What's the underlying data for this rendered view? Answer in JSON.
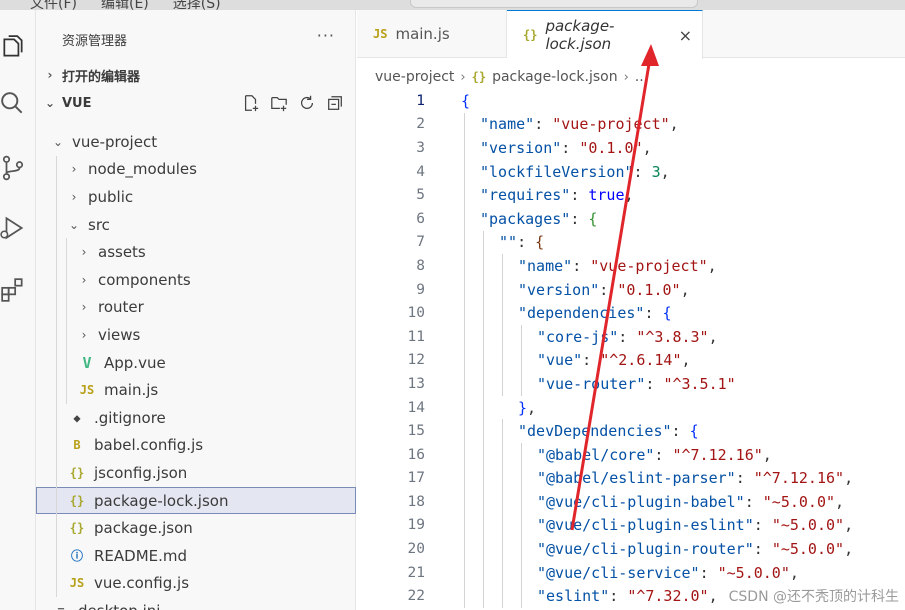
{
  "menu": {
    "items": [
      "文件(F)",
      "编辑(E)",
      "选择(S)"
    ]
  },
  "sidebar": {
    "title": "资源管理器",
    "more": "···",
    "open_editors": "打开的编辑器",
    "workspace": "VUE",
    "tree": [
      {
        "label": "vue-project",
        "chev": "⌄",
        "icon": "",
        "depth": 0
      },
      {
        "label": "node_modules",
        "chev": "›",
        "icon": "",
        "depth": 1
      },
      {
        "label": "public",
        "chev": "›",
        "icon": "",
        "depth": 1
      },
      {
        "label": "src",
        "chev": "⌄",
        "icon": "",
        "depth": 1
      },
      {
        "label": "assets",
        "chev": "›",
        "icon": "",
        "depth": 2
      },
      {
        "label": "components",
        "chev": "›",
        "icon": "",
        "depth": 2
      },
      {
        "label": "router",
        "chev": "›",
        "icon": "",
        "depth": 2
      },
      {
        "label": "views",
        "chev": "›",
        "icon": "",
        "depth": 2
      },
      {
        "label": "App.vue",
        "chev": "",
        "icon": "V",
        "depth": 2
      },
      {
        "label": "main.js",
        "chev": "",
        "icon": "JS",
        "depth": 2
      },
      {
        "label": ".gitignore",
        "chev": "",
        "icon": "◆",
        "depth": 1
      },
      {
        "label": "babel.config.js",
        "chev": "",
        "icon": "B",
        "depth": 1
      },
      {
        "label": "jsconfig.json",
        "chev": "",
        "icon": "{}",
        "depth": 1
      },
      {
        "label": "package-lock.json",
        "chev": "",
        "icon": "{}",
        "depth": 1
      },
      {
        "label": "package.json",
        "chev": "",
        "icon": "{}",
        "depth": 1
      },
      {
        "label": "README.md",
        "chev": "",
        "icon": "ⓘ",
        "depth": 1
      },
      {
        "label": "vue.config.js",
        "chev": "",
        "icon": "JS",
        "depth": 1
      },
      {
        "label": "desktop.ini",
        "chev": "",
        "icon": "≡",
        "depth": 0
      }
    ]
  },
  "tabs": [
    {
      "icon": "JS",
      "label": "main.js"
    },
    {
      "icon": "{}",
      "label": "package-lock.json",
      "close": "×"
    }
  ],
  "breadcrumb": {
    "folder": "vue-project",
    "icon": "{}",
    "file": "package-lock.json",
    "more": "..."
  },
  "code_lines": [
    {
      "n": "1"
    },
    {
      "n": "2"
    },
    {
      "n": "3"
    },
    {
      "n": "4"
    },
    {
      "n": "5"
    },
    {
      "n": "6"
    },
    {
      "n": "7"
    },
    {
      "n": "8"
    },
    {
      "n": "9"
    },
    {
      "n": "10"
    },
    {
      "n": "11"
    },
    {
      "n": "12"
    },
    {
      "n": "13"
    },
    {
      "n": "14"
    },
    {
      "n": "15"
    },
    {
      "n": "16"
    },
    {
      "n": "17"
    },
    {
      "n": "18"
    },
    {
      "n": "19"
    },
    {
      "n": "20"
    },
    {
      "n": "21"
    },
    {
      "n": "22"
    }
  ],
  "watermark": "CSDN @还不秃顶的计科生",
  "colors": {
    "accent": "#0078d4",
    "selection": "#e4e6f1",
    "arrow": "#e0262b",
    "key": "#0451a5",
    "string": "#a31515",
    "number": "#098658"
  }
}
